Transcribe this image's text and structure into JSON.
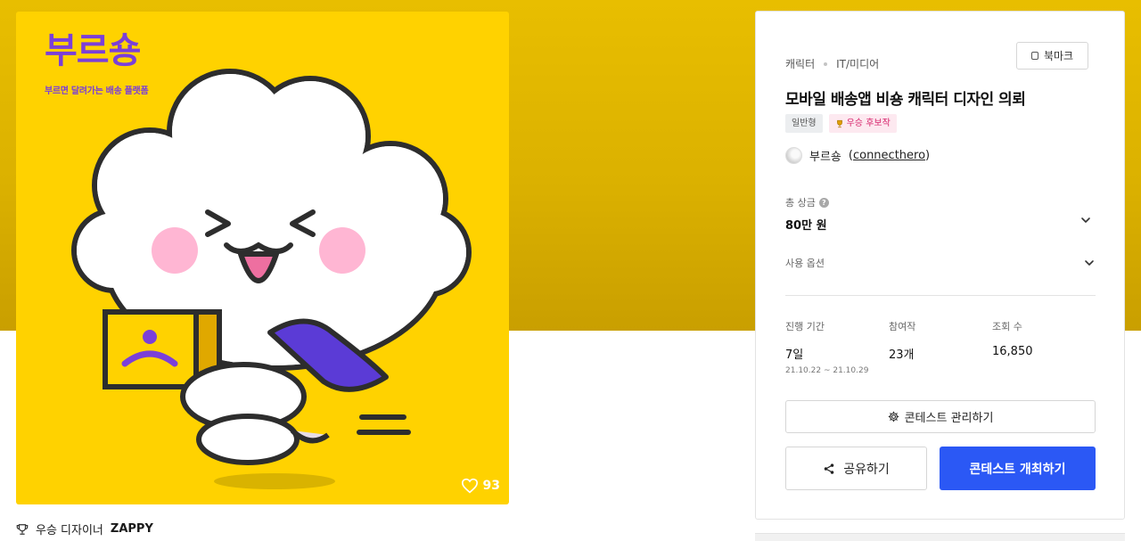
{
  "artwork": {
    "brand_name": "부르숑",
    "brand_tagline": "부르면 달려가는 배송 플랫폼",
    "likes": "93",
    "colors": {
      "background": "#ffd200",
      "brand": "#7b3fd9"
    }
  },
  "designer": {
    "label": "우승 디자이너",
    "name": "ZAPPY"
  },
  "panel": {
    "bookmark_label": "북마크",
    "category": "캐릭터",
    "subcategory": "IT/미디어",
    "title": "모바일 배송앱 비숑 캐릭터 디자인 의뢰",
    "badges": {
      "type": "일반형",
      "award": "우승 후보작"
    },
    "owner": {
      "name": "부르숑",
      "handle": "connecthero"
    },
    "prize": {
      "label": "총 상금",
      "value": "80만 원"
    },
    "usage_label": "사용 옵션",
    "stats": [
      {
        "label": "진행 기간",
        "value": "7일",
        "sub": "21.10.22 ~ 21.10.29"
      },
      {
        "label": "참여작",
        "value": "23개",
        "sub": ""
      },
      {
        "label": "조회 수",
        "value": "16,850",
        "sub": ""
      }
    ],
    "manage_button": "콘테스트 관리하기",
    "share_button": "공유하기",
    "open_button": "콘테스트 개최하기",
    "accent_color": "#2b58f5"
  }
}
